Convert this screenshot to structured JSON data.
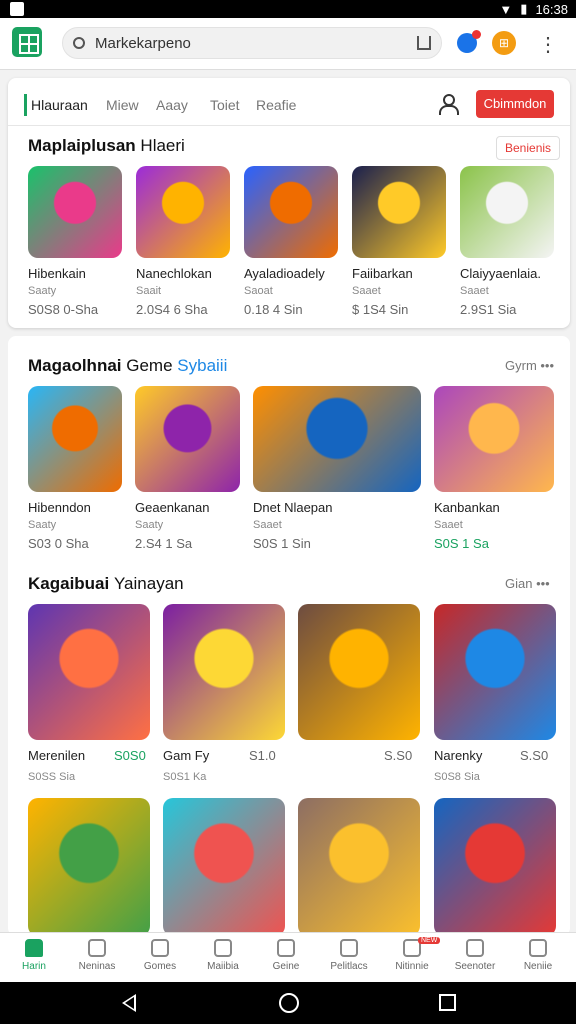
{
  "status": {
    "time": "16:38"
  },
  "browser": {
    "url": "Markekarpeno"
  },
  "tabs": {
    "items": [
      "Hlauraan",
      "Miew",
      "Aaay",
      "Toiet",
      "Reafie"
    ],
    "cta": "Cbimmdon"
  },
  "section1": {
    "title_bold": "Maplaiplusan",
    "title_light": "Hlaeri",
    "action": "Benienis",
    "games": [
      {
        "name": "Hibenkain",
        "sub": "Saaty",
        "price": "S0S8 0-Sha",
        "colors": [
          "#19c26b",
          "#ea3a8a"
        ]
      },
      {
        "name": "Nanechlokan",
        "sub": "Saait",
        "price": "2.0S4 6 Sha",
        "colors": [
          "#9b2bd9",
          "#ffb300"
        ]
      },
      {
        "name": "Ayaladioadely",
        "sub": "Saoat",
        "price": "0.18 4 Sin",
        "colors": [
          "#2962ff",
          "#ef6c00"
        ]
      },
      {
        "name": "Faiibarkan",
        "sub": "Saaet",
        "price": "$ 1S4 Sin",
        "colors": [
          "#1a1f4d",
          "#ffca28"
        ]
      },
      {
        "name": "Claiyyaenlaia.",
        "sub": "Saaet",
        "price": "2.9S1 Sia",
        "colors": [
          "#8bc34a",
          "#f4f4f4"
        ]
      }
    ]
  },
  "section2": {
    "title_bold": "Magaolhnai",
    "title_light": "Geme",
    "title_accent": "Sybaiii",
    "more": "Gyrm •••",
    "games": [
      {
        "name": "Hibenndon",
        "sub": "Saaty",
        "price": "S03 0 Sha",
        "colors": [
          "#29b6f6",
          "#ef6c00"
        ]
      },
      {
        "name": "Geaenkanan",
        "sub": "Saaty",
        "price": "2.S4 1 Sa",
        "colors": [
          "#ffca28",
          "#8e24aa"
        ]
      },
      {
        "name": "Dnet Nlaepan",
        "sub": "Saaet",
        "price": "S0S 1 Sin",
        "colors": [
          "#ff8f00",
          "#1565c0"
        ]
      },
      {
        "name": "Kanbankan",
        "sub": "Saaet",
        "price": "S0S 1 Sa",
        "green": true,
        "colors": [
          "#ab47bc",
          "#ffb74d"
        ]
      }
    ]
  },
  "section3": {
    "title_bold": "Kagaibuai",
    "title_light": "Yainayan",
    "more": "Gian •••",
    "games": [
      {
        "name": "Merenilen",
        "sub": "S0SS Sia",
        "price": "S0S0",
        "green": true,
        "colors": [
          "#5e35b1",
          "#ff7043"
        ]
      },
      {
        "name": "Gam Fy",
        "sub": "S0S1 Ka",
        "price": "S1.0",
        "colors": [
          "#7b1fa2",
          "#fdd835"
        ]
      },
      {
        "name": "",
        "sub": "",
        "price": "S.S0",
        "colors": [
          "#6d4c41",
          "#ffb300"
        ]
      },
      {
        "name": "Narenky",
        "sub": "S0S8 Sia",
        "price": "S.S0",
        "colors": [
          "#c62828",
          "#1e88e5"
        ]
      }
    ],
    "games_row2": [
      {
        "colors": [
          "#ffb300",
          "#43a047"
        ]
      },
      {
        "colors": [
          "#26c6da",
          "#ef5350"
        ]
      },
      {
        "colors": [
          "#8d6e63",
          "#fbc02d"
        ]
      },
      {
        "colors": [
          "#1565c0",
          "#e53935"
        ]
      }
    ]
  },
  "bottomnav": [
    {
      "label": "Harin",
      "active": true
    },
    {
      "label": "Neninas"
    },
    {
      "label": "Gomes"
    },
    {
      "label": "Maiibia"
    },
    {
      "label": "Geine"
    },
    {
      "label": "Pelitlacs"
    },
    {
      "label": "Nitinnie",
      "badge": "NEW"
    },
    {
      "label": "Seenoter"
    },
    {
      "label": "Neniie"
    }
  ]
}
